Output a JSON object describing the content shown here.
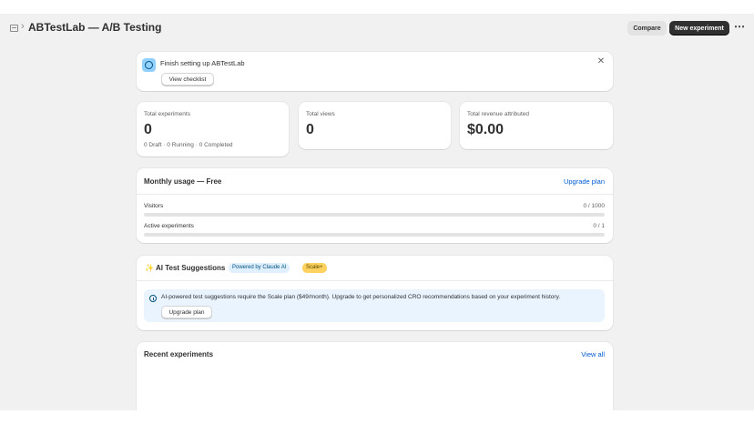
{
  "header": {
    "title": "ABTestLab — A/B Testing",
    "breadcrumb_separator": "›",
    "compare_label": "Compare",
    "new_experiment_label": "New experiment",
    "more_label": "⋯"
  },
  "banner": {
    "title": "Finish setting up ABTestLab",
    "checklist_label": "View checklist",
    "close_label": "✕"
  },
  "stats": [
    {
      "label": "Total experiments",
      "value": "0",
      "sub": "0 Draft · 0 Running · 0 Completed"
    },
    {
      "label": "Total views",
      "value": "0"
    },
    {
      "label": "Total revenue attributed",
      "value": "$0.00"
    }
  ],
  "usage": {
    "title": "Monthly usage — Free",
    "upgrade_label": "Upgrade plan",
    "meters": [
      {
        "label": "Visitors",
        "value": "0 / 1000",
        "fraction": 0
      },
      {
        "label": "Active experiments",
        "value": "0 / 1",
        "fraction": 0
      }
    ]
  },
  "ai": {
    "sparkle": "✨",
    "title": "AI Test Suggestions",
    "badge_powered": "Powered by Claude AI",
    "badge_scale": "Scale+",
    "notice": "AI-powered test suggestions require the Scale plan ($49/month). Upgrade to get personalized CRO recommendations based on your experiment history.",
    "upgrade_label": "Upgrade plan"
  },
  "recent": {
    "title": "Recent experiments",
    "view_all_label": "View all"
  },
  "colors": {
    "page_bg": "#f1f1f1",
    "primary_button": "#303030",
    "link": "#005bd3",
    "info_bg": "#eaf4ff",
    "scale_badge": "#ffd15e"
  }
}
